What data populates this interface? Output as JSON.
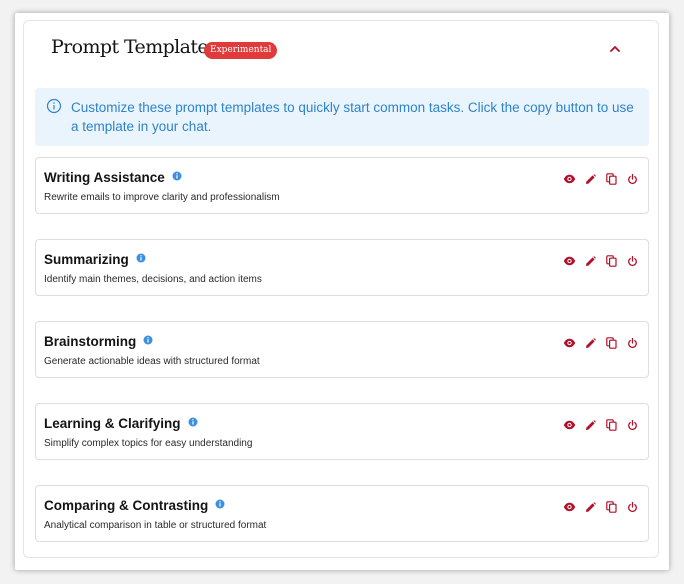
{
  "header": {
    "title": "Prompt Templates",
    "badge": "Experimental",
    "collapse_icon": "chevron-up-icon"
  },
  "info": {
    "icon": "info-circle-icon",
    "text": "Customize these prompt templates to quickly start common tasks. Click the copy button to use a template in your chat."
  },
  "templates": [
    {
      "name": "Writing Assistance",
      "description": "Rewrite emails to improve clarity and professionalism"
    },
    {
      "name": "Summarizing",
      "description": "Identify main themes, decisions, and action items"
    },
    {
      "name": "Brainstorming",
      "description": "Generate actionable ideas with structured format"
    },
    {
      "name": "Learning & Clarifying",
      "description": "Simplify complex topics for easy understanding"
    },
    {
      "name": "Comparing & Contrasting",
      "description": "Analytical comparison in table or structured format"
    }
  ],
  "actions": [
    "view-icon",
    "edit-icon",
    "copy-icon",
    "reset-icon"
  ],
  "colors": {
    "accent": "#b0102b",
    "badge": "#e03a3a",
    "info_text": "#2f83c9",
    "info_bg": "#e9f4fd",
    "tip": "#3d8fe0"
  }
}
